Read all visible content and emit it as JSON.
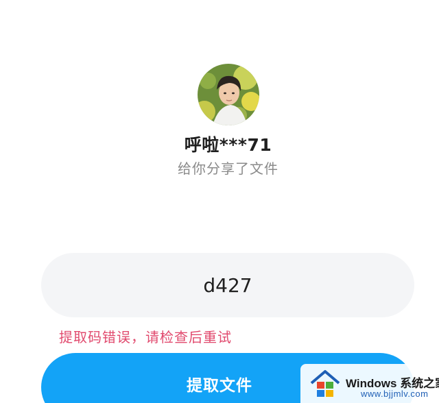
{
  "share": {
    "username": "呼啦***71",
    "subtitle": "给你分享了文件"
  },
  "code_input": {
    "value": "d427"
  },
  "error": {
    "message": "提取码错误，请检查后重试"
  },
  "actions": {
    "extract_label": "提取文件"
  },
  "watermark": {
    "brand": "Windows",
    "suffix": "系统之家",
    "url": "www.bjjmlv.com"
  },
  "colors": {
    "primary": "#13a3f7",
    "error": "#e14a6e",
    "field_bg": "#f4f5f7",
    "muted_text": "#8a8a8a"
  }
}
